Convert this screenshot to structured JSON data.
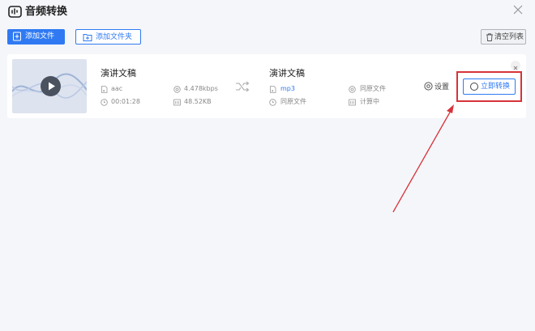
{
  "app": {
    "title": "音频转换"
  },
  "toolbar": {
    "add_file_label": "添加文件",
    "add_folder_label": "添加文件夹",
    "clear_list_label": "清空列表"
  },
  "file": {
    "source": {
      "name": "演讲文稿",
      "format": "aac",
      "bitrate": "4.478kbps",
      "duration": "00:01:28",
      "size": "48.52KB"
    },
    "output": {
      "name": "演讲文稿",
      "format": "mp3",
      "quality": "同原文件",
      "channel": "同原文件",
      "size": "计算中"
    },
    "settings_label": "设置",
    "convert_label": "立即转换"
  },
  "colors": {
    "accent": "#2f7af3",
    "highlight": "#d7333a",
    "background": "#f5f6fa"
  },
  "icons": [
    "app-logo-icon",
    "close-icon",
    "add-file-icon",
    "add-folder-icon",
    "trash-icon",
    "play-icon",
    "music-file-icon",
    "clock-icon",
    "bitrate-icon",
    "size-icon",
    "shuffle-icon",
    "settings-icon",
    "convert-icon",
    "remove-icon"
  ]
}
